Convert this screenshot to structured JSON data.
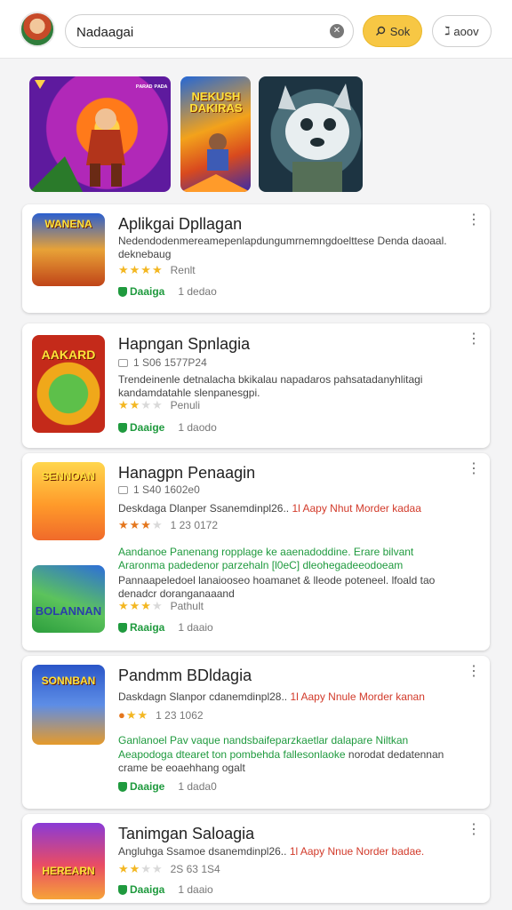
{
  "header": {
    "search_value": "Nadaagai",
    "clear_icon": "clear-icon",
    "search_button_label": "Sok",
    "about_button_label": "aoov"
  },
  "banners": [
    {
      "text": "ᴾᴬᴿᴬᴰ ᴾᴬᴰᴬ"
    },
    {
      "text": "NEKUSH DAKIRAS"
    },
    {
      "text": ""
    }
  ],
  "apps": [
    {
      "icon_text": "WANENA",
      "title": "Aplikgai Dpllagan",
      "desc1": "Nedendodenmereamepenlapdungumrnemngdoelttese Denda daoaal.",
      "desc2": "deknebaug",
      "rating_label": "Renlt",
      "badge": "Daaiga",
      "size": "1 dedao"
    },
    {
      "icon_text": "AAKARD",
      "title": "Hapngan Spnlagia",
      "meta": "1 S06  1577P24",
      "desc1": "Trendeinenle detnalacha bkikalau napadaros pahsatadanyhlitagi",
      "desc2": "kandamdatahle slenpanesgpi.",
      "rating_label": "Penuli",
      "badge": "Daaige",
      "size": "1 daodo"
    },
    {
      "icon_text": "SENNOAN",
      "title": "Hanagpn Penaagin",
      "meta": "1 S40  1602e0",
      "desc_black": "Deskdaga Dlanper Ssanemdinpl26..",
      "desc_red": "1l Aapy Nhut Morder kadaa",
      "rating_label": "1 23  0172",
      "desc_green1": "Aandanoe Panenang ropplage ke aaenadoddine. Erare bilvant",
      "desc_green2": "Araronma padedenor parzehaln [l0eC] dleohegadeeodoeam",
      "desc3": "Pannaapeledoel lanaiooseo hoamanet & lleode poteneel. lfoald tao",
      "desc4": "denadcr doranganaaand",
      "rating_label2": "Pathult",
      "badge": "Raaiga",
      "size": "1 daaio",
      "second_icon_text": "BOLANNAN"
    },
    {
      "icon_text": "SONNBAN",
      "title": "Pandmm BDldagia",
      "desc_black": "Daskdagn Slanpor cdanemdinpl28..",
      "desc_red": "1l Aapy Nnule Morder kanan",
      "rating_label": "1 23  1062",
      "desc_green1": "Ganlanoel Pav vaque nandsbaifeparzkaetlar dalapare Niltkan",
      "desc_green2": "Aeapodoga dtearet ton pombehda fallesonlaoke",
      "desc_green2_tail": "norodat dedatennan",
      "desc3": "crame be eoaehhang ogalt",
      "badge": "Daaige",
      "size": "1 dada0"
    },
    {
      "icon_text": "HEREARN",
      "title": "Tanimgan Saloagia",
      "desc_black": "Angluhga Ssamoe dsanemdinpl26..",
      "desc_red": "1l Aapy Nnue Norder badae.",
      "rating_label": "2S 63 1S4",
      "badge": "Daaiga",
      "size": "1 daaio"
    }
  ],
  "colors": {
    "accent_yellow": "#f7c744",
    "install_green": "#1f9a3e",
    "highlight_red": "#d23a2a",
    "star_gold": "#f3b722"
  }
}
